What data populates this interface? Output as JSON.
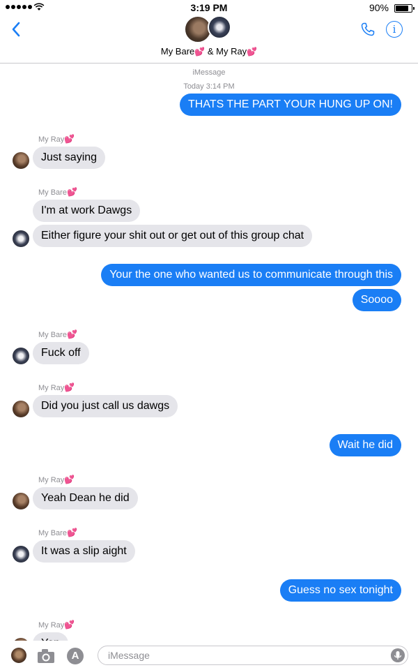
{
  "status": {
    "time": "3:19 PM",
    "battery": "90%",
    "battery_fraction": 0.9
  },
  "header": {
    "contact_1": "My Bare",
    "joiner": " & ",
    "contact_2": "My Ray",
    "heart": "💕"
  },
  "thread": {
    "service": "iMessage",
    "timestamp": "Today 3:14 PM",
    "messages": [
      {
        "dir": "out",
        "text": "THATS THE PART YOUR HUNG UP ON!"
      },
      {
        "dir": "in",
        "sender": "My Ray",
        "text": "Just saying"
      },
      {
        "dir": "in",
        "sender": "My Bare",
        "text": "I'm at work Dawgs"
      },
      {
        "dir": "in",
        "text": "Either figure your shit out or get out of this group chat"
      },
      {
        "dir": "out",
        "text": "Your the one who wanted us to communicate through this"
      },
      {
        "dir": "out",
        "text": "Soooo"
      },
      {
        "dir": "in",
        "sender": "My Bare",
        "text": "Fuck off"
      },
      {
        "dir": "in",
        "sender": "My Ray",
        "text": "Did you just call us dawgs"
      },
      {
        "dir": "out",
        "text": "Wait he did"
      },
      {
        "dir": "in",
        "sender": "My Ray",
        "text": "Yeah Dean he did"
      },
      {
        "dir": "in",
        "sender": "My Bare",
        "text": "It was a slip aight"
      },
      {
        "dir": "out",
        "text": "Guess no sex tonight"
      },
      {
        "dir": "in",
        "sender": "My Ray",
        "text": "Yep"
      }
    ]
  },
  "input": {
    "placeholder": "iMessage"
  },
  "icons": {
    "back": "chevron-left-icon",
    "phone": "phone-icon",
    "info": "info-icon",
    "camera": "camera-icon",
    "appstore": "app-store-icon",
    "mic": "microphone-icon"
  },
  "colors": {
    "accent": "#1a7ef5",
    "incoming": "#e5e5ea",
    "meta": "#8e8e93",
    "heart": "#ff4fa3"
  }
}
